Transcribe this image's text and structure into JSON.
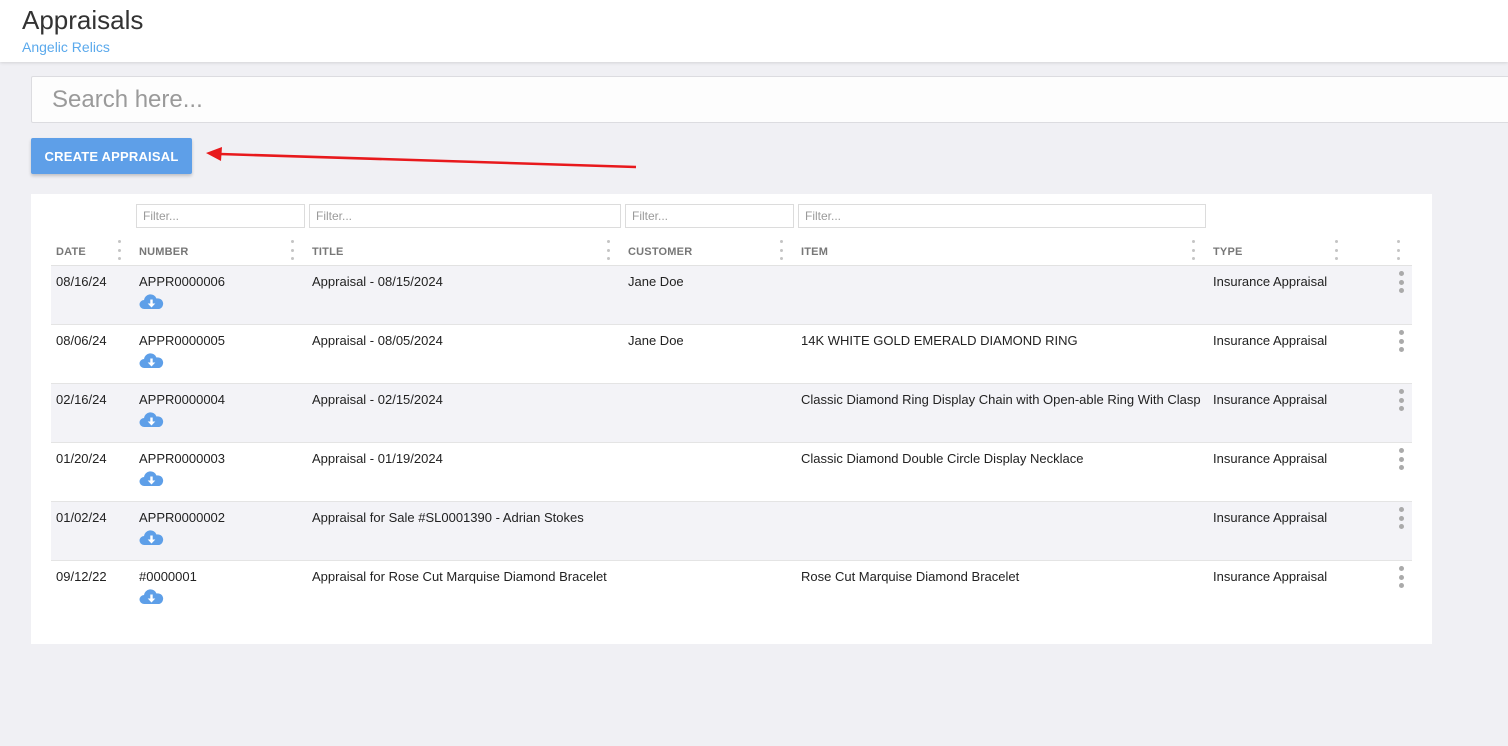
{
  "header": {
    "title": "Appraisals",
    "subtitle": "Angelic Relics"
  },
  "search": {
    "placeholder": "Search here..."
  },
  "toolbar": {
    "create_label": "CREATE APPRAISAL"
  },
  "accent_color": "#5e9fe8",
  "annotation_color": "#e8191c",
  "filters": [
    {
      "placeholder": "Filter..."
    },
    {
      "placeholder": "Filter..."
    },
    {
      "placeholder": "Filter..."
    },
    {
      "placeholder": "Filter..."
    }
  ],
  "table": {
    "columns": [
      "DATE",
      "NUMBER",
      "TITLE",
      "CUSTOMER",
      "ITEM",
      "TYPE"
    ],
    "rows": [
      {
        "date": "08/16/24",
        "number": "APPR0000006",
        "title": "Appraisal - 08/15/2024",
        "customer": "Jane Doe",
        "item": "",
        "type": "Insurance Appraisal"
      },
      {
        "date": "08/06/24",
        "number": "APPR0000005",
        "title": "Appraisal - 08/05/2024",
        "customer": "Jane Doe",
        "item": "14K WHITE GOLD EMERALD DIAMOND RING",
        "type": "Insurance Appraisal"
      },
      {
        "date": "02/16/24",
        "number": "APPR0000004",
        "title": "Appraisal - 02/15/2024",
        "customer": "",
        "item": "Classic Diamond Ring Display Chain with Open-able Ring With Clasp",
        "type": "Insurance Appraisal"
      },
      {
        "date": "01/20/24",
        "number": "APPR0000003",
        "title": "Appraisal - 01/19/2024",
        "customer": "",
        "item": "Classic Diamond Double Circle Display Necklace",
        "type": "Insurance Appraisal"
      },
      {
        "date": "01/02/24",
        "number": "APPR0000002",
        "title": "Appraisal for Sale #SL0001390 - Adrian Stokes",
        "customer": "",
        "item": "",
        "type": "Insurance Appraisal"
      },
      {
        "date": "09/12/22",
        "number": "#0000001",
        "title": "Appraisal for Rose Cut Marquise Diamond Bracelet",
        "customer": "",
        "item": "Rose Cut Marquise Diamond Bracelet",
        "type": "Insurance Appraisal"
      }
    ],
    "row_icons": {
      "download": "cloud-download-icon",
      "menu": "kebab-menu-icon"
    }
  }
}
